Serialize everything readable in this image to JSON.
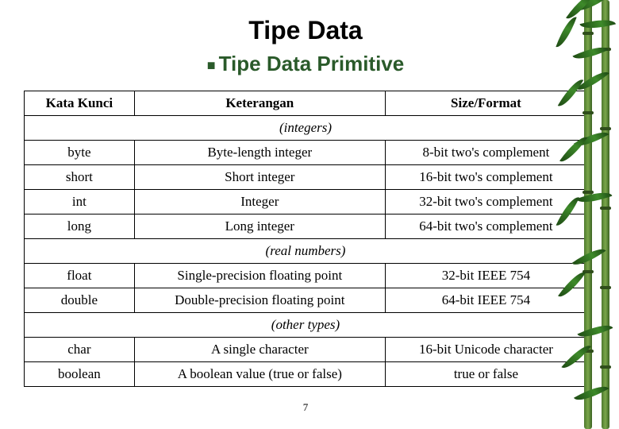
{
  "title": "Tipe Data",
  "subtitle": "Tipe Data Primitive",
  "headers": {
    "col1": "Kata Kunci",
    "col2": "Keterangan",
    "col3": "Size/Format"
  },
  "sections": {
    "integers": "(integers)",
    "reals": "(real numbers)",
    "others": "(other types)"
  },
  "rows": {
    "byte": {
      "kw": "byte",
      "desc": "Byte-length integer",
      "fmt": "8-bit two's complement"
    },
    "short": {
      "kw": "short",
      "desc": "Short integer",
      "fmt": "16-bit two's complement"
    },
    "int": {
      "kw": "int",
      "desc": "Integer",
      "fmt": "32-bit two's complement"
    },
    "long": {
      "kw": "long",
      "desc": "Long integer",
      "fmt": "64-bit two's complement"
    },
    "float": {
      "kw": "float",
      "desc": "Single-precision floating point",
      "fmt": "32-bit IEEE 754"
    },
    "double": {
      "kw": "double",
      "desc": "Double-precision floating point",
      "fmt": "64-bit IEEE 754"
    },
    "char": {
      "kw": "char",
      "desc": "A single character",
      "fmt": "16-bit Unicode character"
    },
    "boolean": {
      "kw": "boolean",
      "desc": "A boolean value (true or false)",
      "fmt": "true or false"
    }
  },
  "pagenum": "7"
}
